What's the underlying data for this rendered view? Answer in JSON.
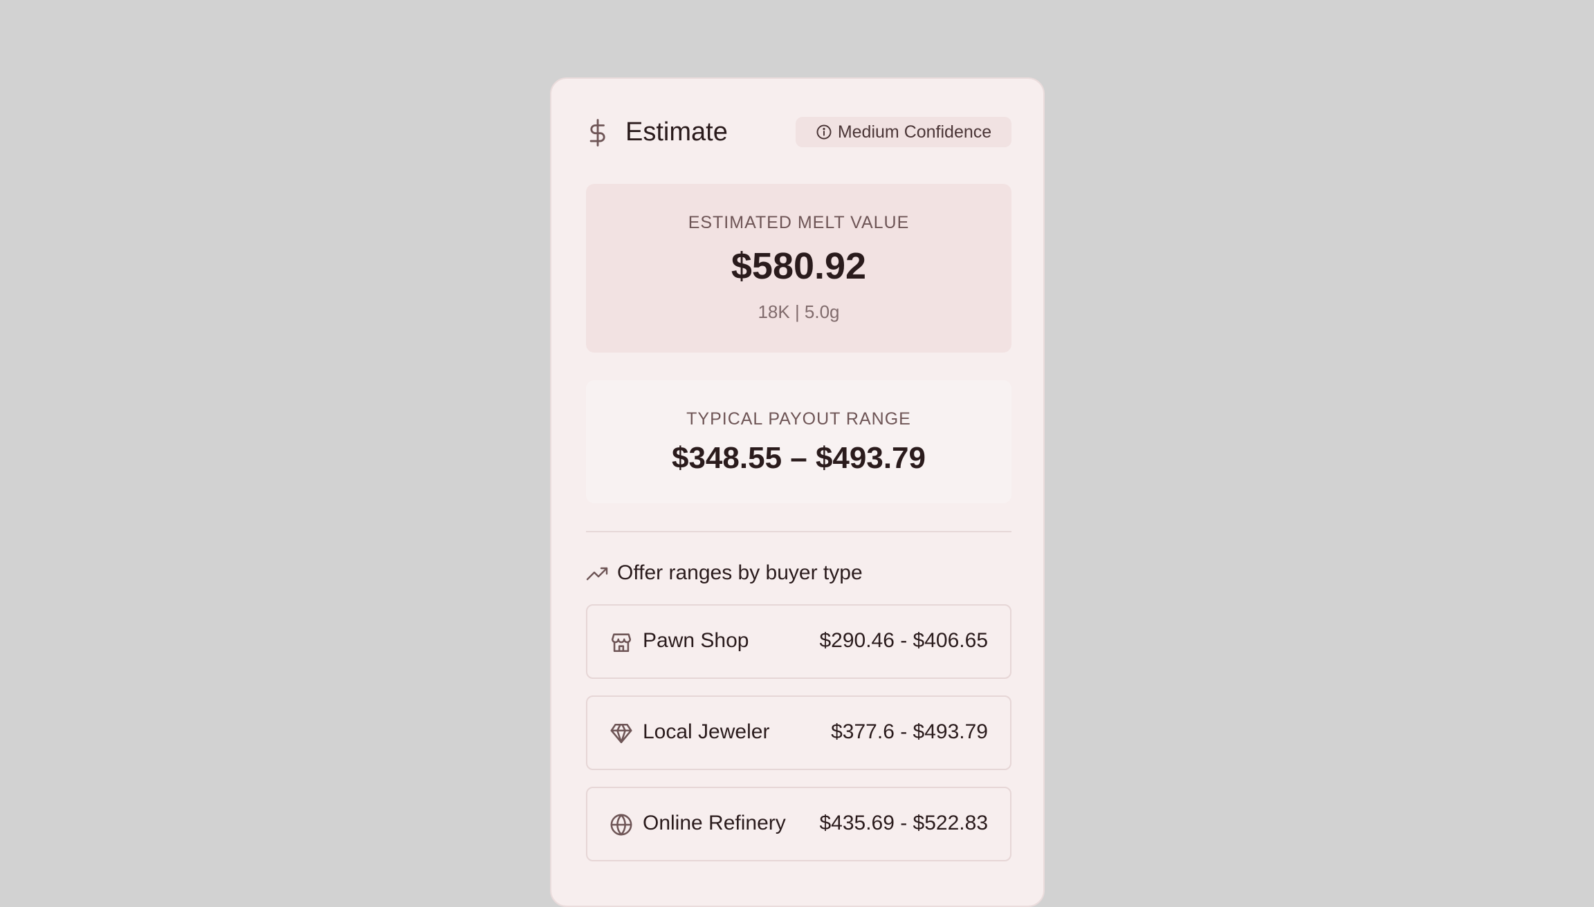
{
  "header": {
    "title": "Estimate",
    "confidence_badge": "Medium Confidence"
  },
  "melt": {
    "label": "ESTIMATED MELT VALUE",
    "value": "$580.92",
    "details": "18K | 5.0g"
  },
  "payout": {
    "label": "TYPICAL PAYOUT RANGE",
    "value": "$348.55 – $493.79"
  },
  "offers": {
    "heading": "Offer ranges by buyer type",
    "buyers": [
      {
        "name": "Pawn Shop",
        "range": "$290.46 - $406.65",
        "icon": "store-icon"
      },
      {
        "name": "Local Jeweler",
        "range": "$377.6 - $493.79",
        "icon": "gem-icon"
      },
      {
        "name": "Online Refinery",
        "range": "$435.69 - $522.83",
        "icon": "globe-icon"
      }
    ]
  },
  "colors": {
    "background": "#d2d2d2",
    "card": "#f7eeee",
    "melt_panel": "#f2e2e2",
    "payout_panel": "#f8f2f2",
    "icon": "#6e5556",
    "text": "#2a1b1c"
  }
}
